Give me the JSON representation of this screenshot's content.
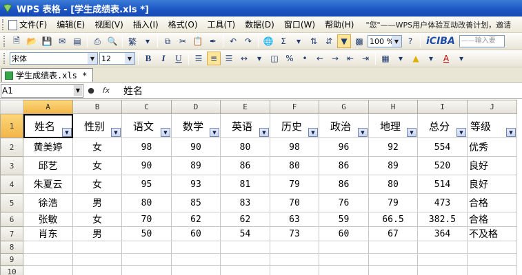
{
  "window": {
    "title": "WPS 表格 - [学生成绩表.xls *]"
  },
  "menu": {
    "items": [
      "文件(F)",
      "编辑(E)",
      "视图(V)",
      "插入(I)",
      "格式(O)",
      "工具(T)",
      "数据(D)",
      "窗口(W)",
      "帮助(H)"
    ],
    "info_text": "\"您\"——WPS用户体验互动改善计划，邀请"
  },
  "toolbar": {
    "zoom": "100 %",
    "iciba_label": "iCIBA",
    "iciba_placeholder": "——输入要",
    "font_name": "宋体",
    "font_size": "12",
    "bold": "B",
    "italic": "I",
    "underline": "U",
    "percent": "%"
  },
  "doc_tab": {
    "label": "学生成绩表.xls *"
  },
  "formula_bar": {
    "cell_ref": "A1",
    "fx": "fx",
    "content": "姓名"
  },
  "sheet": {
    "columns": [
      "A",
      "B",
      "C",
      "D",
      "E",
      "F",
      "G",
      "H",
      "I",
      "J"
    ],
    "row_numbers": [
      "1",
      "2",
      "3",
      "4",
      "5",
      "6",
      "7",
      "8",
      "9",
      "10"
    ],
    "header": [
      "姓名",
      "性别",
      "语文",
      "数学",
      "英语",
      "历史",
      "政治",
      "地理",
      "总分",
      "等级"
    ],
    "rows": [
      [
        "黄美婷",
        "女",
        "98",
        "90",
        "80",
        "98",
        "96",
        "92",
        "554",
        "优秀"
      ],
      [
        "邱艺",
        "女",
        "90",
        "89",
        "86",
        "80",
        "86",
        "89",
        "520",
        "良好"
      ],
      [
        "朱夏云",
        "女",
        "95",
        "93",
        "81",
        "79",
        "86",
        "80",
        "514",
        "良好"
      ],
      [
        "徐浩",
        "男",
        "80",
        "85",
        "83",
        "70",
        "76",
        "79",
        "473",
        "合格"
      ],
      [
        "张敏",
        "女",
        "70",
        "62",
        "62",
        "63",
        "59",
        "66.5",
        "382.5",
        "合格"
      ],
      [
        "肖东",
        "男",
        "50",
        "60",
        "54",
        "73",
        "60",
        "67",
        "364",
        "不及格"
      ]
    ]
  },
  "colors": {
    "title_bar": "#1c55c4",
    "selected_header": "#f2b447",
    "grid_line": "#c8c8c8"
  }
}
